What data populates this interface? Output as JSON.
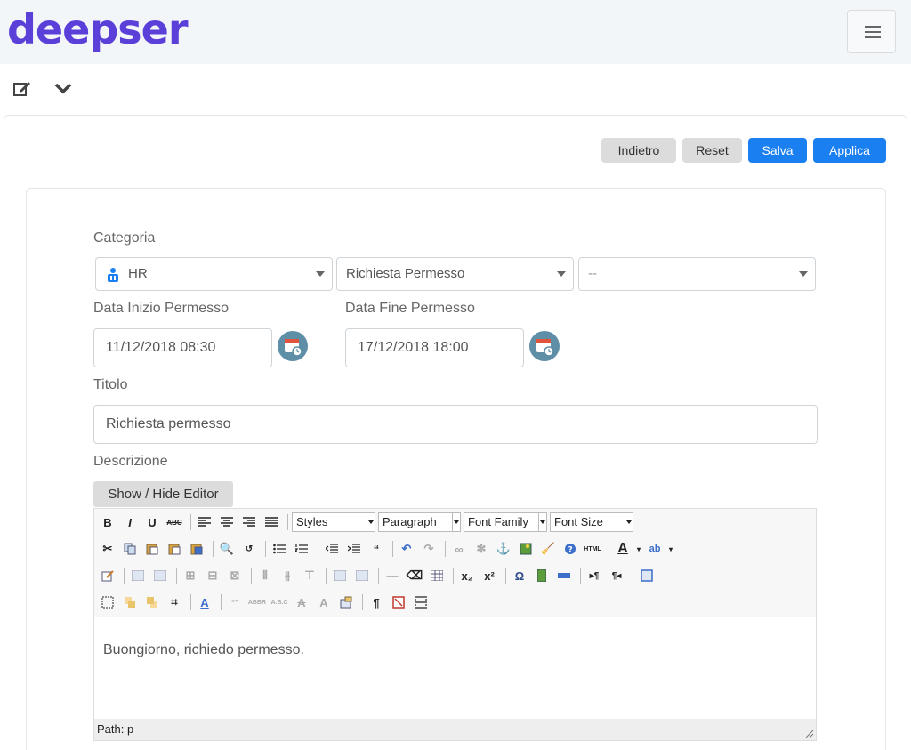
{
  "header": {
    "logo_text": "deepser"
  },
  "actions": {
    "back": "Indietro",
    "reset": "Reset",
    "save": "Salva",
    "apply": "Applica"
  },
  "form": {
    "category_label": "Categoria",
    "category1": "HR",
    "category2": "Richiesta Permesso",
    "category3": "--",
    "start_label": "Data Inizio Permesso",
    "start_value": "11/12/2018 08:30",
    "end_label": "Data Fine Permesso",
    "end_value": "17/12/2018 18:00",
    "title_label": "Titolo",
    "title_value": "Richiesta permesso",
    "description_label": "Descrizione",
    "show_hide": "Show / Hide Editor"
  },
  "editor": {
    "styles": "Styles",
    "paragraph": "Paragraph",
    "font_family": "Font Family",
    "font_size": "Font Size",
    "content": "Buongiorno, richiedo permesso.",
    "path": "Path: p"
  },
  "colors": {
    "brand": "#5b3fd9",
    "primary": "#1a7ff0",
    "calendar": "#5f8ea7"
  }
}
